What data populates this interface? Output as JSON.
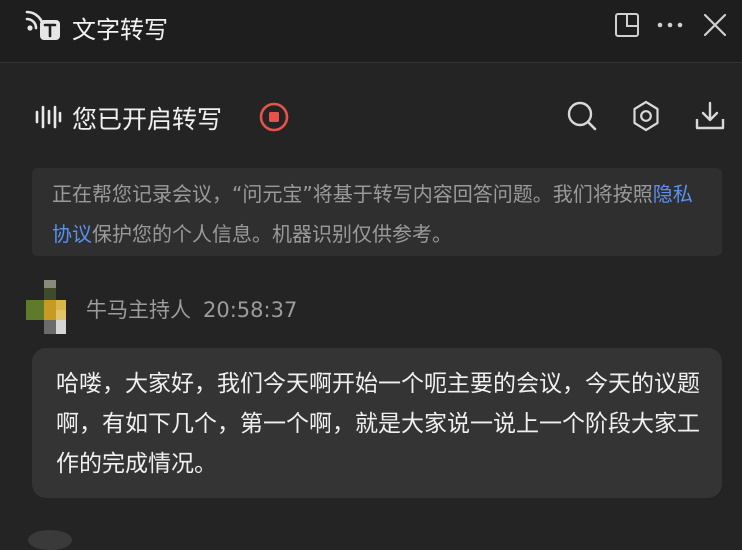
{
  "window": {
    "title": "文字转写",
    "icons": {
      "app": "podcast-translate-icon",
      "pin": "pin-window-icon",
      "more": "more-icon",
      "close": "close-icon"
    }
  },
  "toolbar": {
    "status": "您已开启转写",
    "icons": {
      "waveform": "waveform-icon",
      "stop": "stop-record-icon",
      "search": "search-icon",
      "settings": "gear-icon",
      "download": "download-icon"
    },
    "stop_color": "#e5534b"
  },
  "notice": {
    "text_before": "正在帮您记录会议，“问元宝”将基于转写内容回答问题。我们将按照",
    "link": "隐私协议",
    "text_after": "保护您的个人信息。机器识别仅供参考。",
    "link_color": "#5a8ff0"
  },
  "transcript": [
    {
      "speaker": "牛马主持人",
      "time": "20:58:37",
      "text": "哈喽，大家好，我们今天啊开始一个呃主要的会议，今天的议题啊，有如下几个，第一个啊，就是大家说一说上一个阶段大家工作的完成情况。"
    }
  ]
}
